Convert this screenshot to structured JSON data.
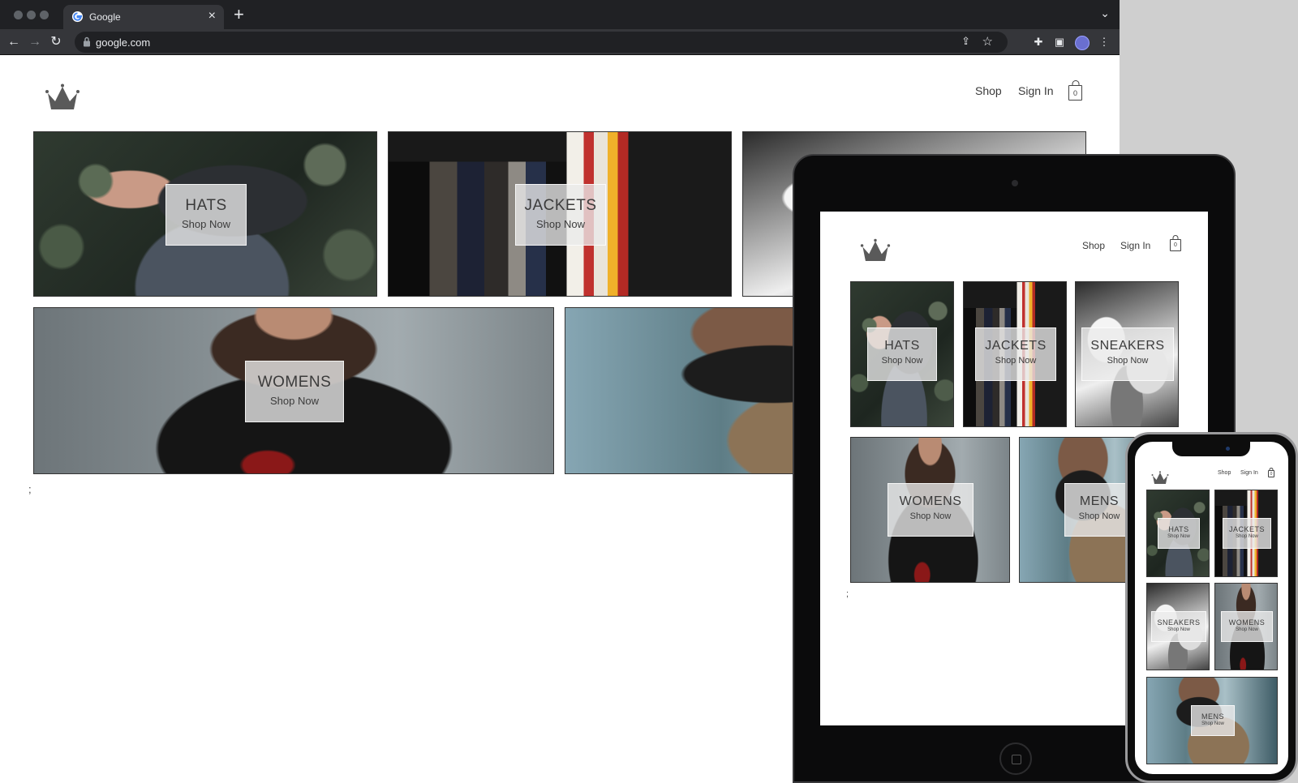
{
  "browser": {
    "tab_title": "Google",
    "tab_close": "×",
    "new_tab": "+",
    "tab_menu": "⌄",
    "url": "google.com",
    "nav": {
      "back": "←",
      "forward": "→",
      "reload": "↻"
    },
    "icons": {
      "share": "⇪",
      "star": "☆",
      "extensions": "✚",
      "sidebar": "▣",
      "menu": "⋮"
    }
  },
  "store": {
    "nav": {
      "shop": "Shop",
      "sign_in": "Sign In"
    },
    "cart_count": "0",
    "trailing_text": ";"
  },
  "tiles": {
    "hats": {
      "title": "HATS",
      "cta": "Shop Now"
    },
    "jackets": {
      "title": "JACKETS",
      "cta": "Shop Now"
    },
    "sneakers": {
      "title": "SNEAKERS",
      "cta": "Shop Now"
    },
    "womens": {
      "title": "WOMENS",
      "cta": "Shop Now"
    },
    "mens": {
      "title": "MENS",
      "cta": "Shop Now"
    }
  },
  "colors": {
    "chrome_dark": "#202124",
    "chrome_toolbar": "#35363a",
    "caption_bg": "#ebebeb",
    "text": "#3b3b3b",
    "profile_avatar": "#6a6fd0"
  }
}
